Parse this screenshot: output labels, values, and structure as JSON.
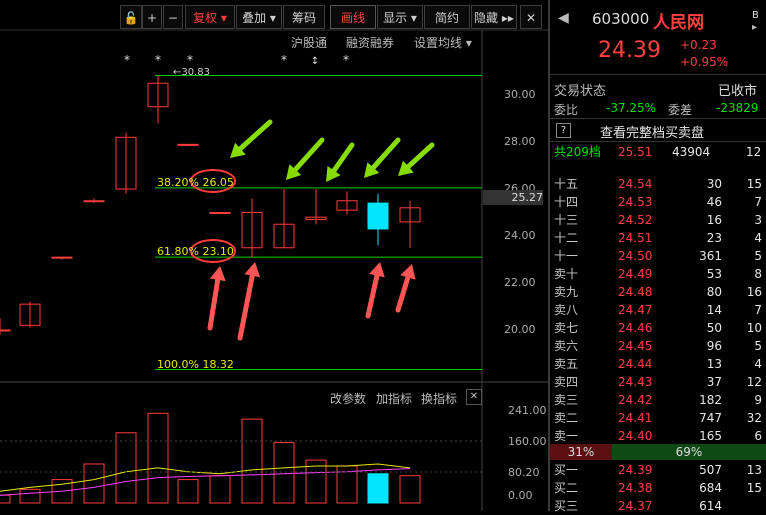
{
  "toolbar": {
    "items": [
      "复权",
      "叠加",
      "筹码",
      "画线",
      "显示",
      "简约",
      "隐藏"
    ],
    "sub_items": [
      "沪股通",
      "融资融券",
      "设置均线"
    ]
  },
  "main_chart": {
    "y_ticks": [
      "30.00",
      "28.00",
      "26.00",
      "24.00",
      "22.00",
      "20.00"
    ],
    "current_price_tag": "25.27",
    "high_label": "30.83",
    "fib_labels": [
      "38.20% 26.05",
      "61.80% 23.10",
      "100.0% 18.32"
    ]
  },
  "indicator": {
    "buttons": [
      "改参数",
      "加指标",
      "换指标"
    ],
    "y_ticks": [
      "241.00",
      "160.00",
      "80.20",
      "0.00"
    ]
  },
  "chart_data": {
    "type": "candlestick",
    "candles": [
      {
        "open": 20.0,
        "high": 20.5,
        "low": 19.8,
        "close": 20.0
      },
      {
        "open": 20.2,
        "high": 21.2,
        "low": 20.1,
        "close": 21.1
      },
      {
        "open": 23.1,
        "high": 23.1,
        "low": 23.0,
        "close": 23.1
      },
      {
        "open": 25.5,
        "high": 25.6,
        "low": 25.4,
        "close": 25.5
      },
      {
        "open": 26.0,
        "high": 28.4,
        "low": 25.8,
        "close": 28.2
      },
      {
        "open": 29.5,
        "high": 30.83,
        "low": 28.8,
        "close": 30.5
      },
      {
        "open": 27.9,
        "high": 27.9,
        "low": 27.9,
        "close": 27.9
      },
      {
        "open": 25.0,
        "high": 25.0,
        "low": 25.0,
        "close": 25.0
      },
      {
        "open": 23.5,
        "high": 25.6,
        "low": 23.1,
        "close": 25.0
      },
      {
        "open": 23.5,
        "high": 26.0,
        "low": 23.5,
        "close": 24.5
      },
      {
        "open": 24.7,
        "high": 26.0,
        "low": 24.5,
        "close": 24.8
      },
      {
        "open": 25.1,
        "high": 25.9,
        "low": 24.9,
        "close": 25.5
      },
      {
        "open": 25.4,
        "high": 25.8,
        "low": 23.6,
        "close": 24.3
      },
      {
        "open": 24.6,
        "high": 25.5,
        "low": 23.5,
        "close": 25.2
      }
    ],
    "volume": [
      20,
      35,
      60,
      100,
      180,
      230,
      60,
      70,
      215,
      155,
      110,
      95,
      75,
      70
    ]
  },
  "panel": {
    "code": "603000",
    "name": "人民网",
    "price": "24.39",
    "change": "+0.23",
    "change_pct": "+0.95%",
    "status_label": "交易状态",
    "status_value": "已收市",
    "ratio_label": "委比",
    "ratio_value": "-37.25%",
    "diff_label": "委差",
    "diff_value": "-23829",
    "full_link": "查看完整档买卖盘",
    "total_label": "共209档",
    "total_price": "25.51",
    "total_vol": "43904",
    "total_cnt": "12",
    "asks": [
      {
        "label": "十五",
        "price": "24.54",
        "vol": "30",
        "cnt": "15"
      },
      {
        "label": "十四",
        "price": "24.53",
        "vol": "46",
        "cnt": "7"
      },
      {
        "label": "十三",
        "price": "24.52",
        "vol": "16",
        "cnt": "3"
      },
      {
        "label": "十二",
        "price": "24.51",
        "vol": "23",
        "cnt": "4"
      },
      {
        "label": "十一",
        "price": "24.50",
        "vol": "361",
        "cnt": "5"
      },
      {
        "label": "卖十",
        "price": "24.49",
        "vol": "53",
        "cnt": "8"
      },
      {
        "label": "卖九",
        "price": "24.48",
        "vol": "80",
        "cnt": "16"
      },
      {
        "label": "卖八",
        "price": "24.47",
        "vol": "14",
        "cnt": "7"
      },
      {
        "label": "卖七",
        "price": "24.46",
        "vol": "50",
        "cnt": "10"
      },
      {
        "label": "卖六",
        "price": "24.45",
        "vol": "96",
        "cnt": "5"
      },
      {
        "label": "卖五",
        "price": "24.44",
        "vol": "13",
        "cnt": "4"
      },
      {
        "label": "卖四",
        "price": "24.43",
        "vol": "37",
        "cnt": "12"
      },
      {
        "label": "卖三",
        "price": "24.42",
        "vol": "182",
        "cnt": "9"
      },
      {
        "label": "卖二",
        "price": "24.41",
        "vol": "747",
        "cnt": "32"
      },
      {
        "label": "卖一",
        "price": "24.40",
        "vol": "165",
        "cnt": "6"
      }
    ],
    "buy_pct": "31%",
    "sell_pct": "69%",
    "bids": [
      {
        "label": "买一",
        "price": "24.39",
        "vol": "507",
        "cnt": "13"
      },
      {
        "label": "买二",
        "price": "24.38",
        "vol": "684",
        "cnt": "15"
      },
      {
        "label": "买三",
        "price": "24.37",
        "vol": "614",
        "cnt": ""
      }
    ]
  }
}
